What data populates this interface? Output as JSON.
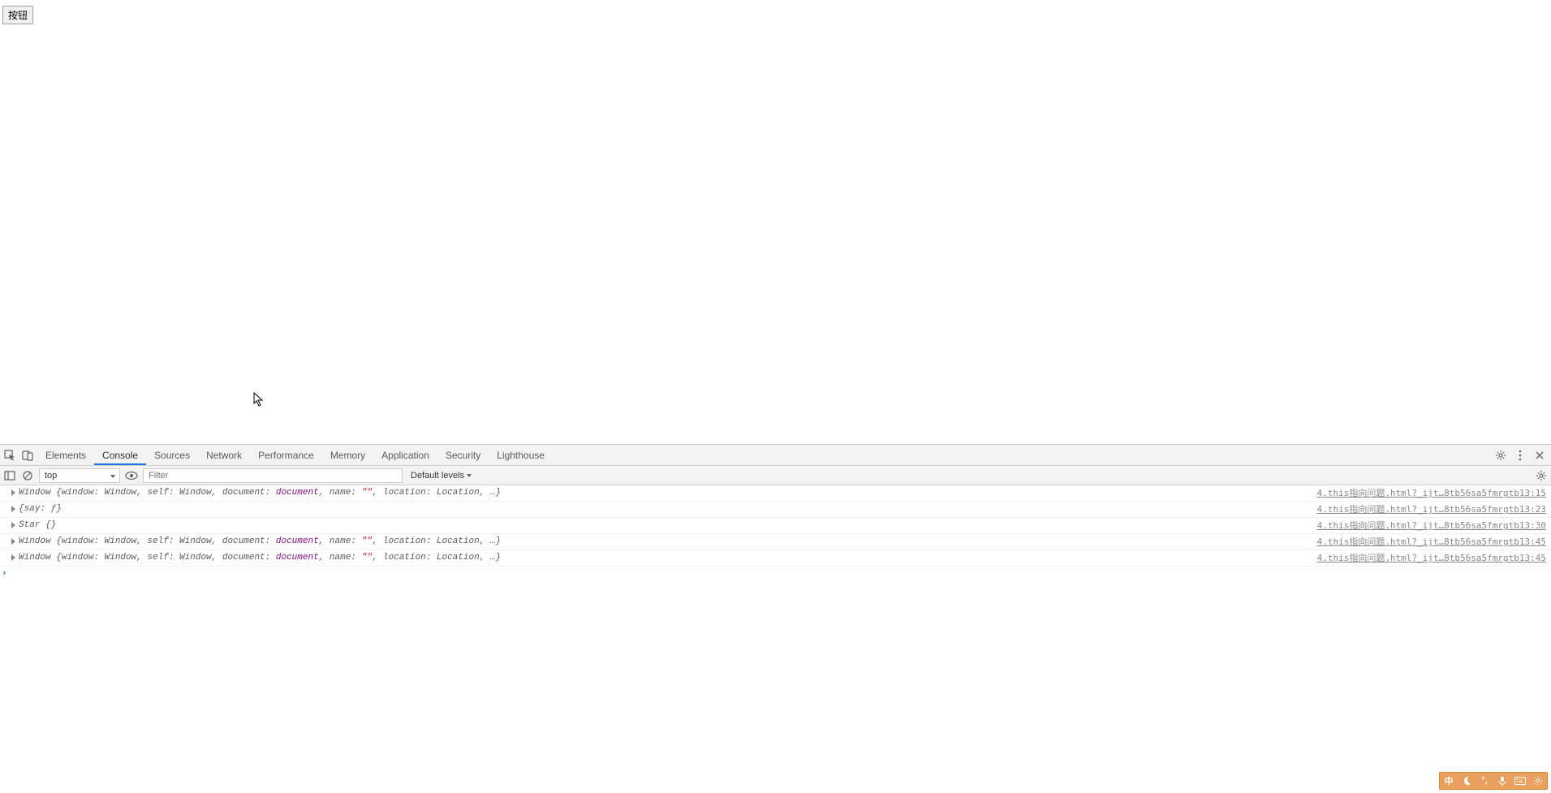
{
  "page": {
    "button_label": "按钮"
  },
  "devtools": {
    "tabs": [
      "Elements",
      "Console",
      "Sources",
      "Network",
      "Performance",
      "Memory",
      "Application",
      "Security",
      "Lighthouse"
    ],
    "active_tab_index": 1,
    "toolbar": {
      "context": "top",
      "filter_placeholder": "Filter",
      "levels_label": "Default levels"
    },
    "console_rows": [
      {
        "kind": "object",
        "parts": [
          {
            "t": "plain",
            "v": "Window "
          },
          {
            "t": "plain",
            "v": "{window: Window, self: Window, document: "
          },
          {
            "t": "link",
            "v": "document"
          },
          {
            "t": "plain",
            "v": ", name: "
          },
          {
            "t": "str",
            "v": "\"\""
          },
          {
            "t": "plain",
            "v": ", location: Location, …}"
          }
        ],
        "source": "4.this指向问题.html?_ijt…8tb56sa5fmrgtb13:15"
      },
      {
        "kind": "object",
        "parts": [
          {
            "t": "plain",
            "v": "{say: ƒ}"
          }
        ],
        "source": "4.this指向问题.html?_ijt…8tb56sa5fmrgtb13:23"
      },
      {
        "kind": "object",
        "parts": [
          {
            "t": "plain",
            "v": "Star {}"
          }
        ],
        "source": "4.this指向问题.html?_ijt…8tb56sa5fmrgtb13:30"
      },
      {
        "kind": "object",
        "parts": [
          {
            "t": "plain",
            "v": "Window "
          },
          {
            "t": "plain",
            "v": "{window: Window, self: Window, document: "
          },
          {
            "t": "link",
            "v": "document"
          },
          {
            "t": "plain",
            "v": ", name: "
          },
          {
            "t": "str",
            "v": "\"\""
          },
          {
            "t": "plain",
            "v": ", location: Location, …}"
          }
        ],
        "source": "4.this指向问题.html?_ijt…8tb56sa5fmrgtb13:45"
      },
      {
        "kind": "object",
        "parts": [
          {
            "t": "plain",
            "v": "Window "
          },
          {
            "t": "plain",
            "v": "{window: Window, self: Window, document: "
          },
          {
            "t": "link",
            "v": "document"
          },
          {
            "t": "plain",
            "v": ", name: "
          },
          {
            "t": "str",
            "v": "\"\""
          },
          {
            "t": "plain",
            "v": ", location: Location, …}"
          }
        ],
        "source": "4.this指向问题.html?_ijt…8tb56sa5fmrgtb13:45"
      }
    ]
  },
  "ime": {
    "mode": "中"
  }
}
